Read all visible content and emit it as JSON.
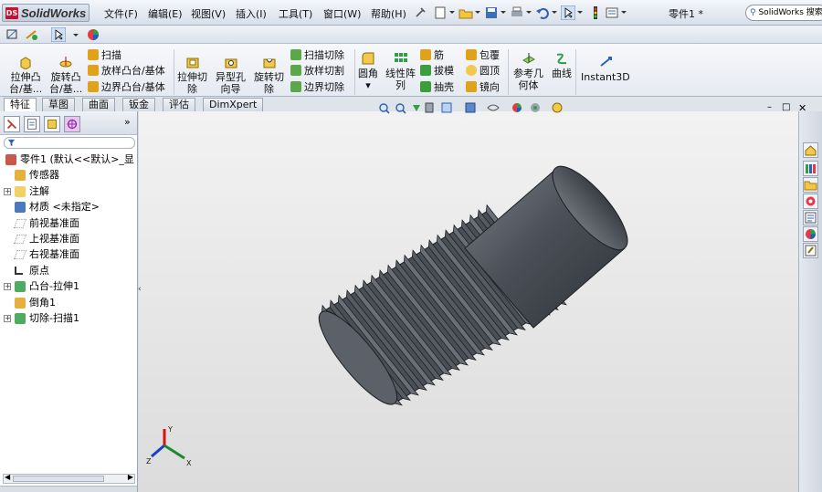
{
  "app": {
    "logo_text": "SolidWorks",
    "logo_mark": "DS",
    "document_title": "零件1 *",
    "search_placeholder": "SolidWorks 搜索"
  },
  "menu": [
    "文件(F)",
    "编辑(E)",
    "视图(V)",
    "插入(I)",
    "工具(T)",
    "窗口(W)",
    "帮助(H)"
  ],
  "command_manager": {
    "big_buttons": [
      {
        "label1": "拉伸凸",
        "label2": "台/基..."
      },
      {
        "label1": "旋转凸",
        "label2": "台/基..."
      },
      {
        "label1": "拉伸切",
        "label2": "除"
      },
      {
        "label1": "异型孔",
        "label2": "向导"
      },
      {
        "label1": "旋转切",
        "label2": "除"
      },
      {
        "label1": "圆角",
        "label2": ""
      },
      {
        "label1": "线性阵",
        "label2": "列"
      },
      {
        "label1": "参考几",
        "label2": "何体"
      },
      {
        "label1": "曲线",
        "label2": ""
      },
      {
        "label1": "Instant3D",
        "label2": ""
      }
    ],
    "stack1": [
      "扫描",
      "放样凸台/基体",
      "边界凸台/基体"
    ],
    "stack2": [
      "扫描切除",
      "放样切割",
      "边界切除"
    ],
    "stack3": [
      "筋",
      "拔模",
      "抽壳"
    ],
    "stack4": [
      "包覆",
      "圆顶",
      "镜向"
    ]
  },
  "tabs": [
    {
      "label": "特征",
      "active": true
    },
    {
      "label": "草图",
      "active": false
    },
    {
      "label": "曲面",
      "active": false
    },
    {
      "label": "钣金",
      "active": false
    },
    {
      "label": "评估",
      "active": false
    },
    {
      "label": "DimXpert",
      "active": false
    }
  ],
  "feature_tree": [
    {
      "label": "零件1 (默认<<默认>_显",
      "expand": "",
      "icon": "part",
      "indent": 0
    },
    {
      "label": "传感器",
      "expand": "",
      "icon": "sensor",
      "indent": 1
    },
    {
      "label": "注解",
      "expand": "+",
      "icon": "annotation",
      "indent": 1
    },
    {
      "label": "材质 <未指定>",
      "expand": "",
      "icon": "material",
      "indent": 1
    },
    {
      "label": "前视基准面",
      "expand": "",
      "icon": "plane",
      "indent": 1
    },
    {
      "label": "上视基准面",
      "expand": "",
      "icon": "plane",
      "indent": 1
    },
    {
      "label": "右视基准面",
      "expand": "",
      "icon": "plane",
      "indent": 1
    },
    {
      "label": "原点",
      "expand": "",
      "icon": "origin",
      "indent": 1
    },
    {
      "label": "凸台-拉伸1",
      "expand": "+",
      "icon": "extrude",
      "indent": 1
    },
    {
      "label": "倒角1",
      "expand": "",
      "icon": "chamfer",
      "indent": 1
    },
    {
      "label": "切除-扫描1",
      "expand": "+",
      "icon": "sweep",
      "indent": 1
    }
  ],
  "triad": {
    "x": "X",
    "y": "Y",
    "z": "Z"
  },
  "colors": {
    "accent": "#3a6ea5",
    "model_dark": "#3c4046",
    "model_light": "#7d828a",
    "viewport_bg": "#e6e6e6"
  }
}
